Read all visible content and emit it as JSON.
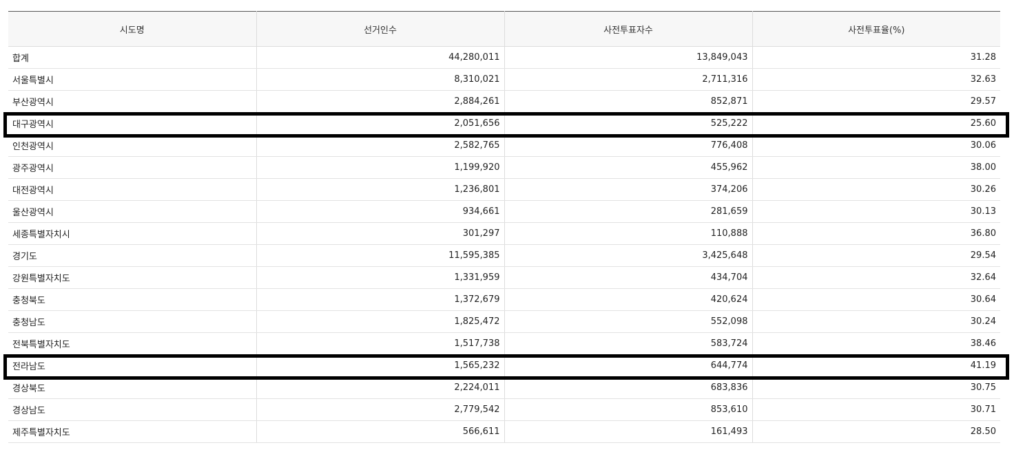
{
  "table": {
    "headers": [
      "시도명",
      "선거인수",
      "사전투표자수",
      "사전투표율(%)"
    ],
    "rows": [
      {
        "region": "합계",
        "electors": "44,280,011",
        "early_voters": "13,849,043",
        "early_rate": "31.28",
        "highlighted": false
      },
      {
        "region": "서울특별시",
        "electors": "8,310,021",
        "early_voters": "2,711,316",
        "early_rate": "32.63",
        "highlighted": false
      },
      {
        "region": "부산광역시",
        "electors": "2,884,261",
        "early_voters": "852,871",
        "early_rate": "29.57",
        "highlighted": false
      },
      {
        "region": "대구광역시",
        "electors": "2,051,656",
        "early_voters": "525,222",
        "early_rate": "25.60",
        "highlighted": true
      },
      {
        "region": "인천광역시",
        "electors": "2,582,765",
        "early_voters": "776,408",
        "early_rate": "30.06",
        "highlighted": false
      },
      {
        "region": "광주광역시",
        "electors": "1,199,920",
        "early_voters": "455,962",
        "early_rate": "38.00",
        "highlighted": false
      },
      {
        "region": "대전광역시",
        "electors": "1,236,801",
        "early_voters": "374,206",
        "early_rate": "30.26",
        "highlighted": false
      },
      {
        "region": "울산광역시",
        "electors": "934,661",
        "early_voters": "281,659",
        "early_rate": "30.13",
        "highlighted": false
      },
      {
        "region": "세종특별자치시",
        "electors": "301,297",
        "early_voters": "110,888",
        "early_rate": "36.80",
        "highlighted": false
      },
      {
        "region": "경기도",
        "electors": "11,595,385",
        "early_voters": "3,425,648",
        "early_rate": "29.54",
        "highlighted": false
      },
      {
        "region": "강원특별자치도",
        "electors": "1,331,959",
        "early_voters": "434,704",
        "early_rate": "32.64",
        "highlighted": false
      },
      {
        "region": "충청북도",
        "electors": "1,372,679",
        "early_voters": "420,624",
        "early_rate": "30.64",
        "highlighted": false
      },
      {
        "region": "충청남도",
        "electors": "1,825,472",
        "early_voters": "552,098",
        "early_rate": "30.24",
        "highlighted": false
      },
      {
        "region": "전북특별자치도",
        "electors": "1,517,738",
        "early_voters": "583,724",
        "early_rate": "38.46",
        "highlighted": false
      },
      {
        "region": "전라남도",
        "electors": "1,565,232",
        "early_voters": "644,774",
        "early_rate": "41.19",
        "highlighted": true
      },
      {
        "region": "경상북도",
        "electors": "2,224,011",
        "early_voters": "683,836",
        "early_rate": "30.75",
        "highlighted": false
      },
      {
        "region": "경상남도",
        "electors": "2,779,542",
        "early_voters": "853,610",
        "early_rate": "30.71",
        "highlighted": false
      },
      {
        "region": "제주특별자치도",
        "electors": "566,611",
        "early_voters": "161,493",
        "early_rate": "28.50",
        "highlighted": false
      }
    ]
  },
  "colors": {
    "header_bg": "#f7f7f7",
    "grid": "#dcdcdc",
    "highlight": "#000000"
  }
}
